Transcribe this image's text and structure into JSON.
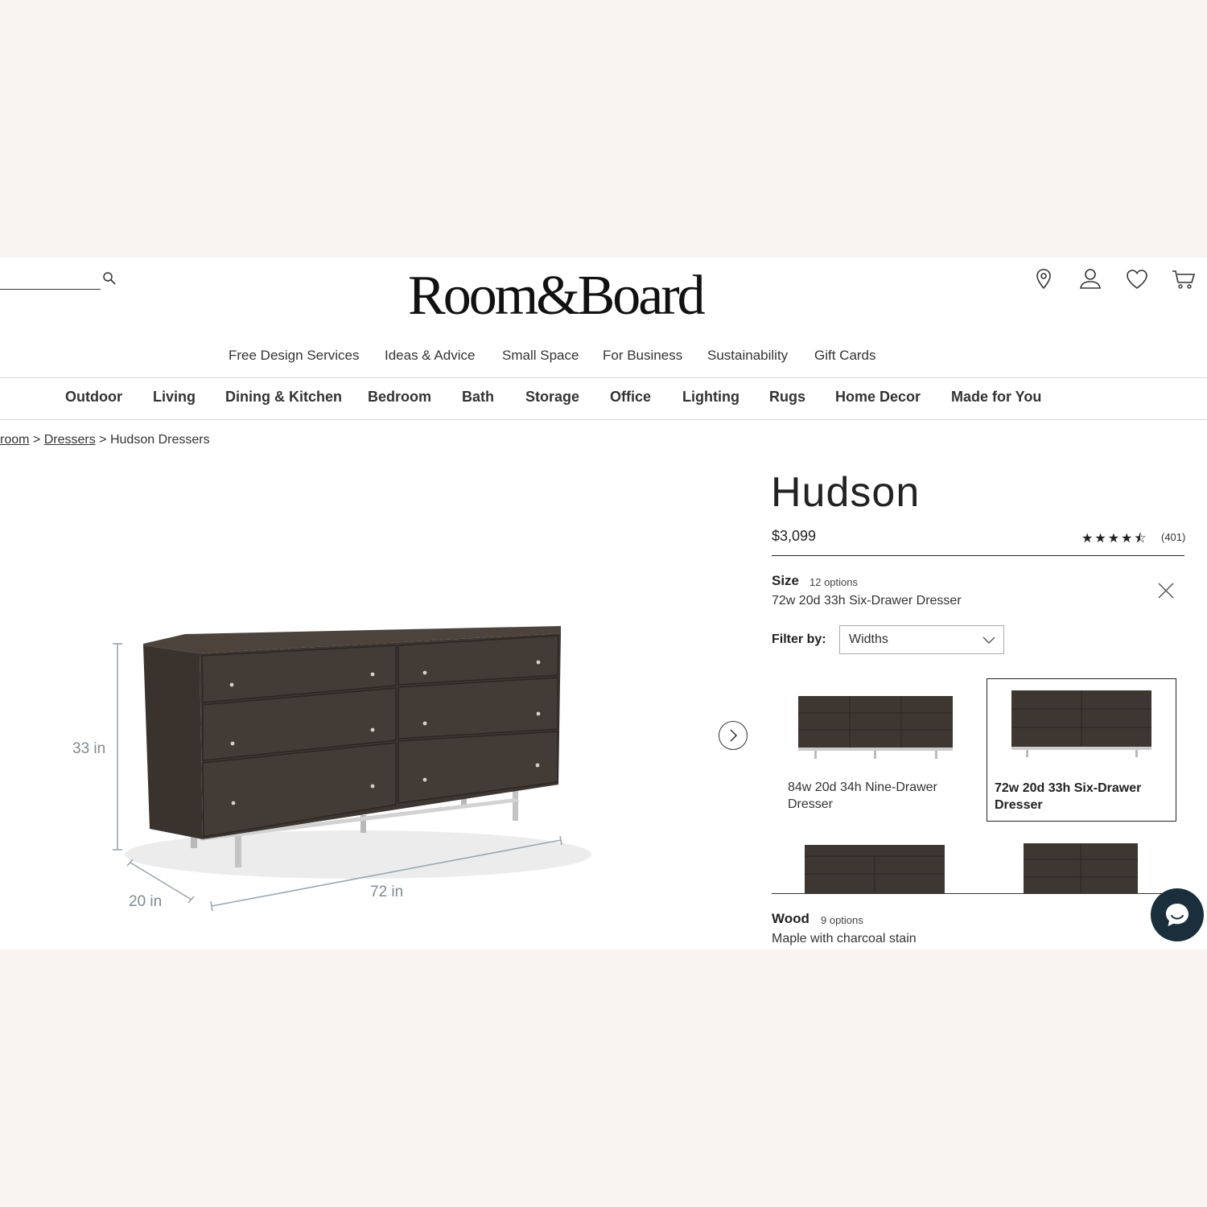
{
  "header": {
    "logo": "Room&Board",
    "utility_icons": [
      "location-pin-icon",
      "account-icon",
      "heart-icon",
      "cart-icon"
    ]
  },
  "secondary_nav": [
    "Free Design Services",
    "Ideas & Advice",
    "Small Space",
    "For Business",
    "Sustainability",
    "Gift Cards"
  ],
  "main_nav": [
    "Outdoor",
    "Living",
    "Dining & Kitchen",
    "Bedroom",
    "Bath",
    "Storage",
    "Office",
    "Lighting",
    "Rugs",
    "Home Decor",
    "Made for You"
  ],
  "breadcrumb": {
    "item1": "room",
    "sep1": ">",
    "item2": "Dressers",
    "sep2": ">",
    "current": "Hudson Dressers"
  },
  "hero": {
    "dim_height": "33 in",
    "dim_depth": "20 in",
    "dim_width": "72 in"
  },
  "product": {
    "title": "Hudson",
    "price": "$3,099",
    "rating_stars": "★★★★⯪",
    "rating": 4.5,
    "reviews": "(401)",
    "size": {
      "label": "Size",
      "options_count": "12 options",
      "selected": "72w 20d 33h Six-Drawer Dresser",
      "filter_label": "Filter by:",
      "filter_value": "Widths",
      "cards": [
        {
          "caption": "84w 20d 34h Nine-Drawer Dresser"
        },
        {
          "caption": "72w 20d 33h Six-Drawer Dresser"
        }
      ]
    },
    "wood": {
      "label": "Wood",
      "options_count": "9 options",
      "selected": "Maple with charcoal stain"
    }
  },
  "colors": {
    "wood": "#3e3731",
    "accent": "#1a2e3b"
  }
}
